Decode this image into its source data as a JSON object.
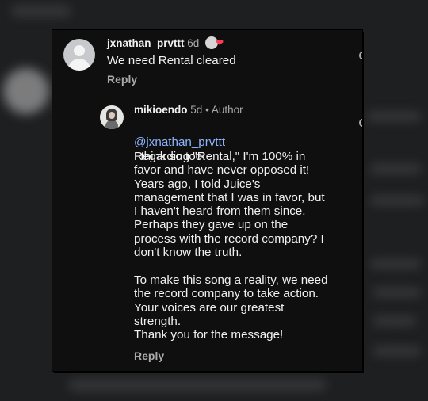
{
  "background_color": "#1e1f21",
  "card_color": "#0f0f0f",
  "mention_color": "#8fb4ff",
  "comment": {
    "username": "jxnathan_prvttt",
    "time": "6d",
    "text": "We need Rental cleared",
    "reply_label": "Reply",
    "liked_by_creator_icon": "heart-icon"
  },
  "reply": {
    "username": "mikioendo",
    "time": "5d",
    "separator": "•",
    "badge": "Author",
    "mention": "@jxnathan_prvttt",
    "first_line": "I think so too!",
    "paragraph_1": "Regarding \"Rental,\" I'm 100% in\nfavor and have never opposed it!\nYears ago, I told Juice's\nmanagement that I was in favor, but\nI haven't heard from them since.\nPerhaps they gave up on the\nprocess with the record company? I\ndon't know the truth.",
    "paragraph_2": "To make this song a reality, we need\nthe record company to take action.\nYour voices are our greatest\nstrength.\nThank you for the message!",
    "reply_label": "Reply"
  }
}
